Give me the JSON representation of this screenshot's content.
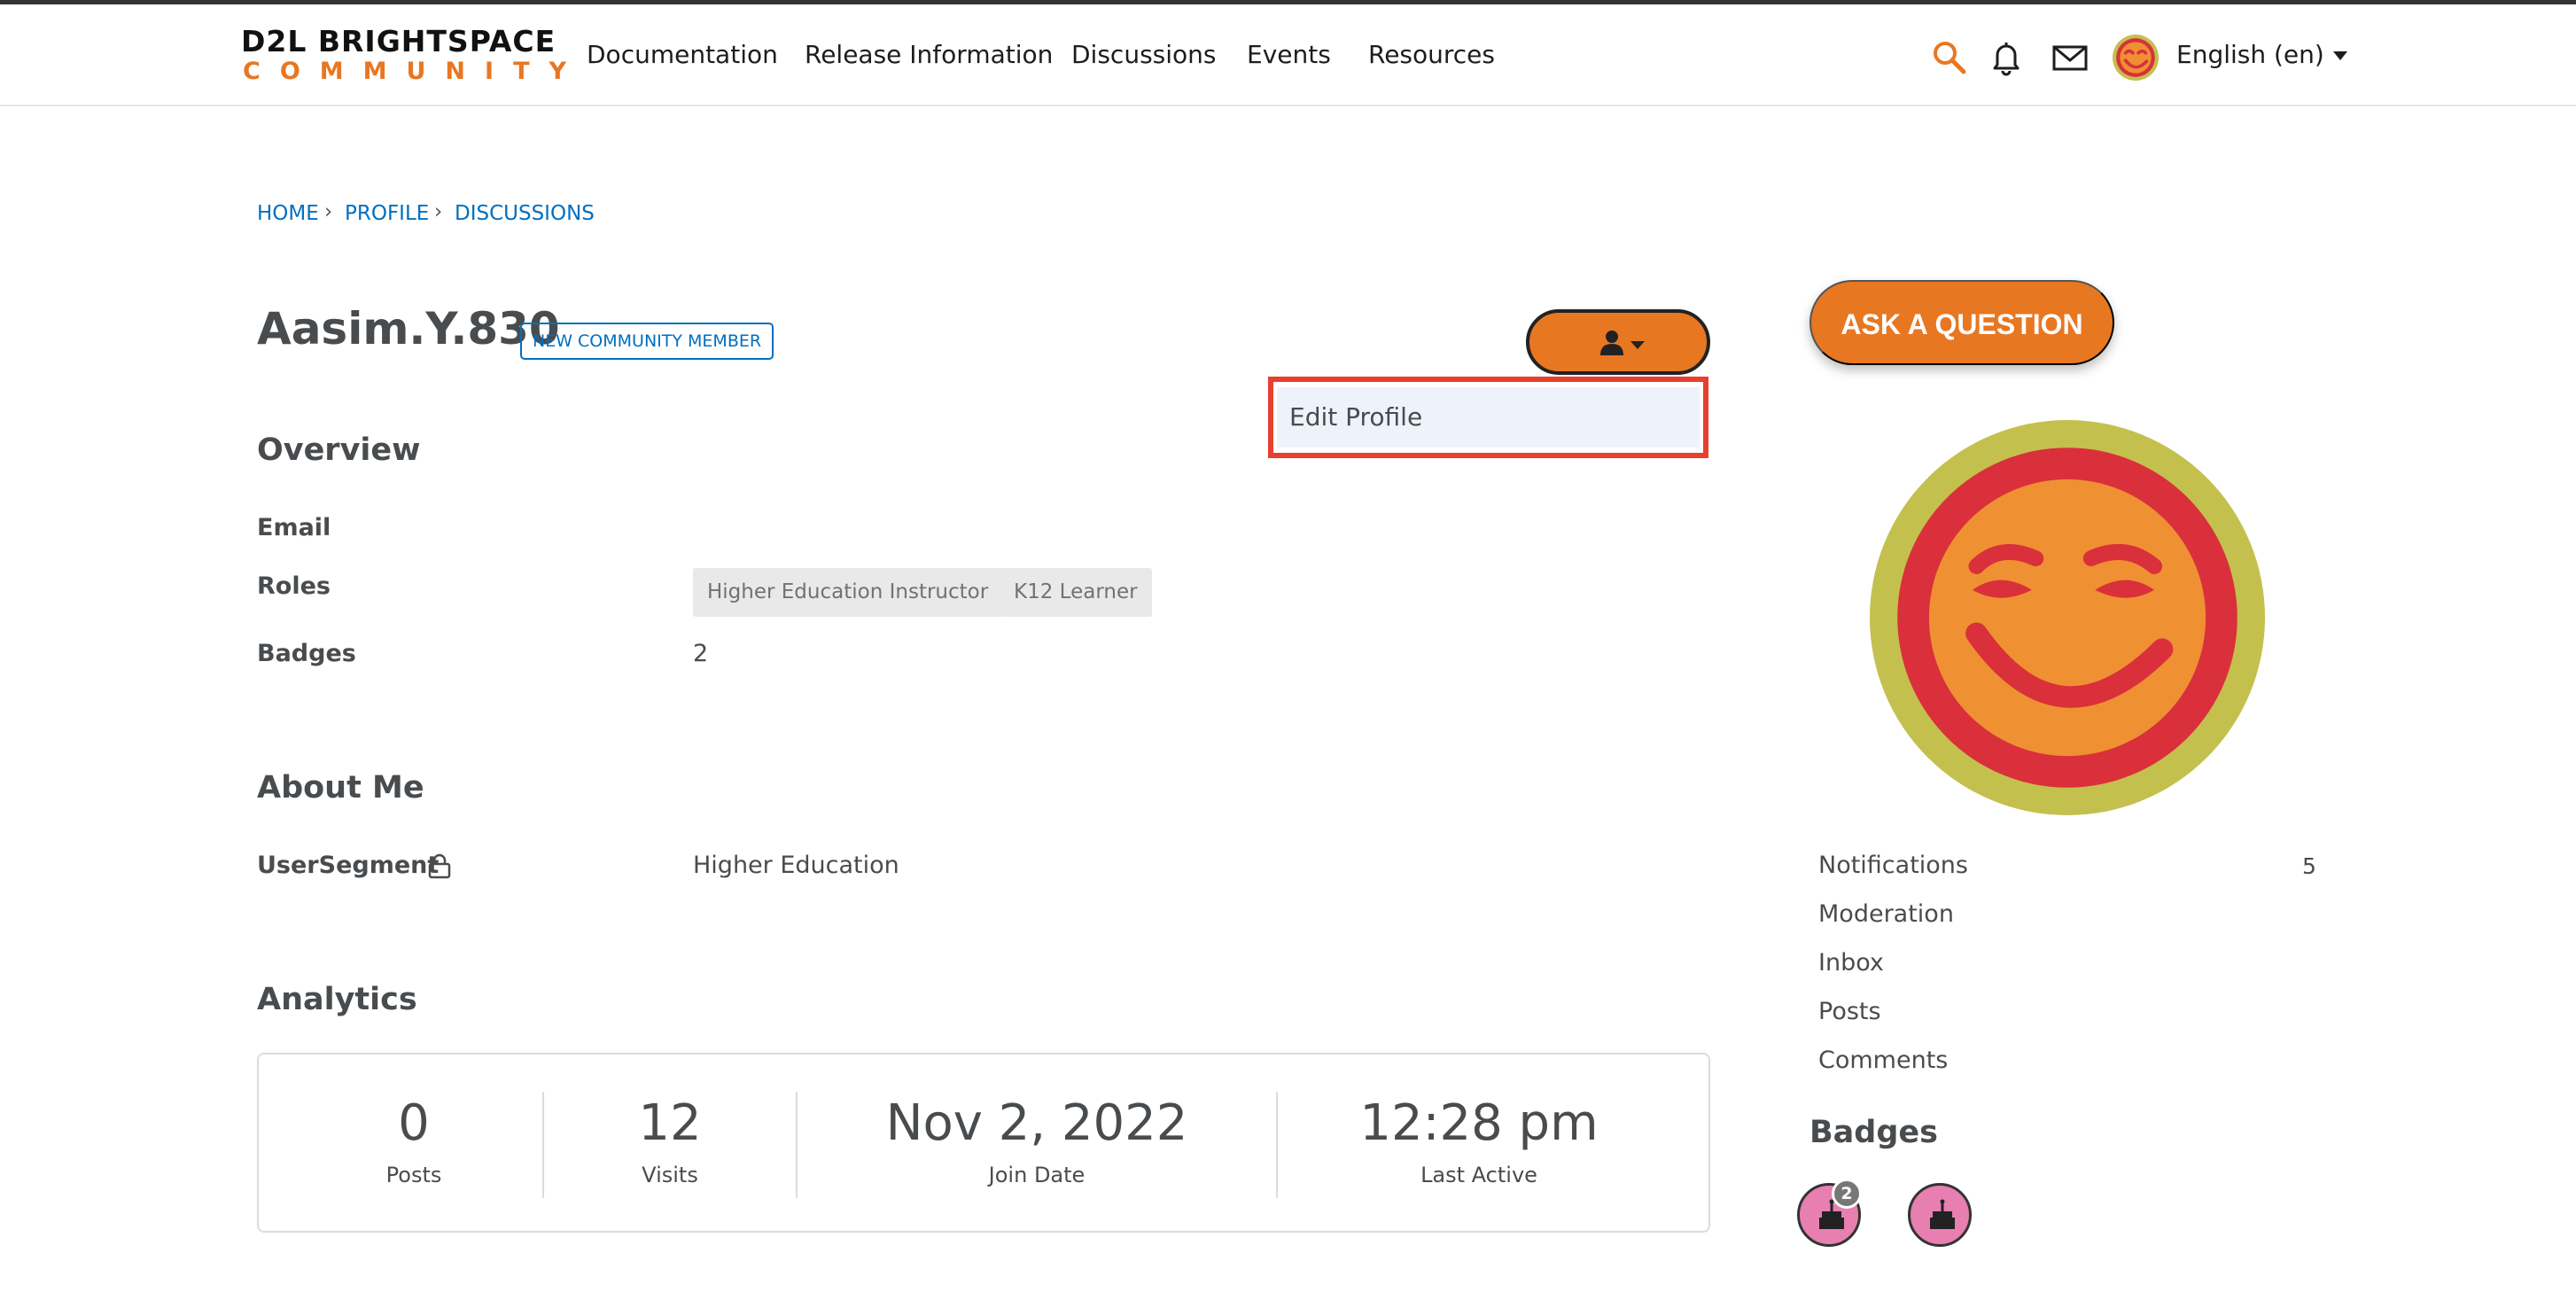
{
  "header": {
    "logo": {
      "line1": "D2L BRIGHTSPACE",
      "line2": "COMMUNITY"
    },
    "nav": [
      "Documentation",
      "Release Information",
      "Discussions",
      "Events",
      "Resources"
    ],
    "language": "English (en)",
    "icons": [
      "search-icon",
      "bell-icon",
      "mail-icon",
      "avatar"
    ]
  },
  "breadcrumb": [
    "HOME",
    "PROFILE",
    "DISCUSSIONS"
  ],
  "profile": {
    "username": "Aasim.Y.830",
    "rank_badge": "NEW COMMUNITY MEMBER",
    "menu_item": "Edit Profile"
  },
  "overview": {
    "title": "Overview",
    "email_label": "Email",
    "roles_label": "Roles",
    "roles": [
      "Higher Education Instructor",
      "K12 Learner"
    ],
    "badges_label": "Badges",
    "badges_value": "2"
  },
  "about": {
    "title": "About Me",
    "segment_label": "UserSegment",
    "segment_value": "Higher Education"
  },
  "analytics": {
    "title": "Analytics",
    "stats": [
      {
        "value": "0",
        "label": "Posts"
      },
      {
        "value": "12",
        "label": "Visits"
      },
      {
        "value": "Nov 2, 2022",
        "label": "Join Date"
      },
      {
        "value": "12:28 pm",
        "label": "Last Active"
      }
    ]
  },
  "sidebar": {
    "ask_button": "ASK A QUESTION",
    "links": [
      {
        "label": "Notifications",
        "count": "5"
      },
      {
        "label": "Moderation"
      },
      {
        "label": "Inbox"
      },
      {
        "label": "Posts"
      },
      {
        "label": "Comments"
      }
    ],
    "badges_title": "Badges",
    "badge_count": "2"
  },
  "colors": {
    "accent": "#e87722",
    "link": "#006fbf",
    "highlight": "#e8402e",
    "text": "#494c4e"
  }
}
